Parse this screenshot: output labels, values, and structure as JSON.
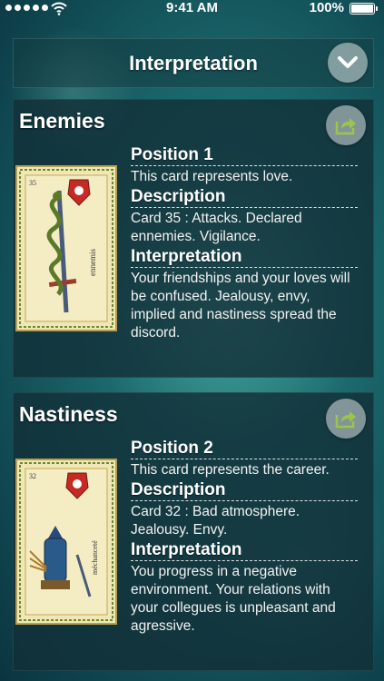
{
  "status_bar": {
    "time": "9:41 AM",
    "battery": "100%"
  },
  "header": {
    "title": "Interpretation"
  },
  "cards": [
    {
      "name": "Enemies",
      "card_word": "ennemis",
      "card_number": "35",
      "position_label": "Position 1",
      "position_text": "This card represents love.",
      "description_label": "Description",
      "description_text": "Card 35 : Attacks. Declared ennemies. Vigilance.",
      "interpretation_label": "Interpretation",
      "interpretation_text": "Your friendships and your loves will be confused. Jealousy, envy, implied and nastiness spread the discord."
    },
    {
      "name": "Nastiness",
      "card_word": "méchanceté",
      "card_number": "32",
      "position_label": "Position 2",
      "position_text": "This card represents the career.",
      "description_label": "Description",
      "description_text": "Card 32 : Bad atmosphere. Jealousy. Envy.",
      "interpretation_label": "Interpretation",
      "interpretation_text": "You progress in a negative environment. Your relations with your collegues is unpleasant and agressive."
    }
  ],
  "icons": {
    "collapse": "chevron-down-icon",
    "share": "share-icon"
  },
  "colors": {
    "panel_bg": "#12303a",
    "share_icon": "#9cc64a",
    "card_bg": "#efe7b8"
  }
}
